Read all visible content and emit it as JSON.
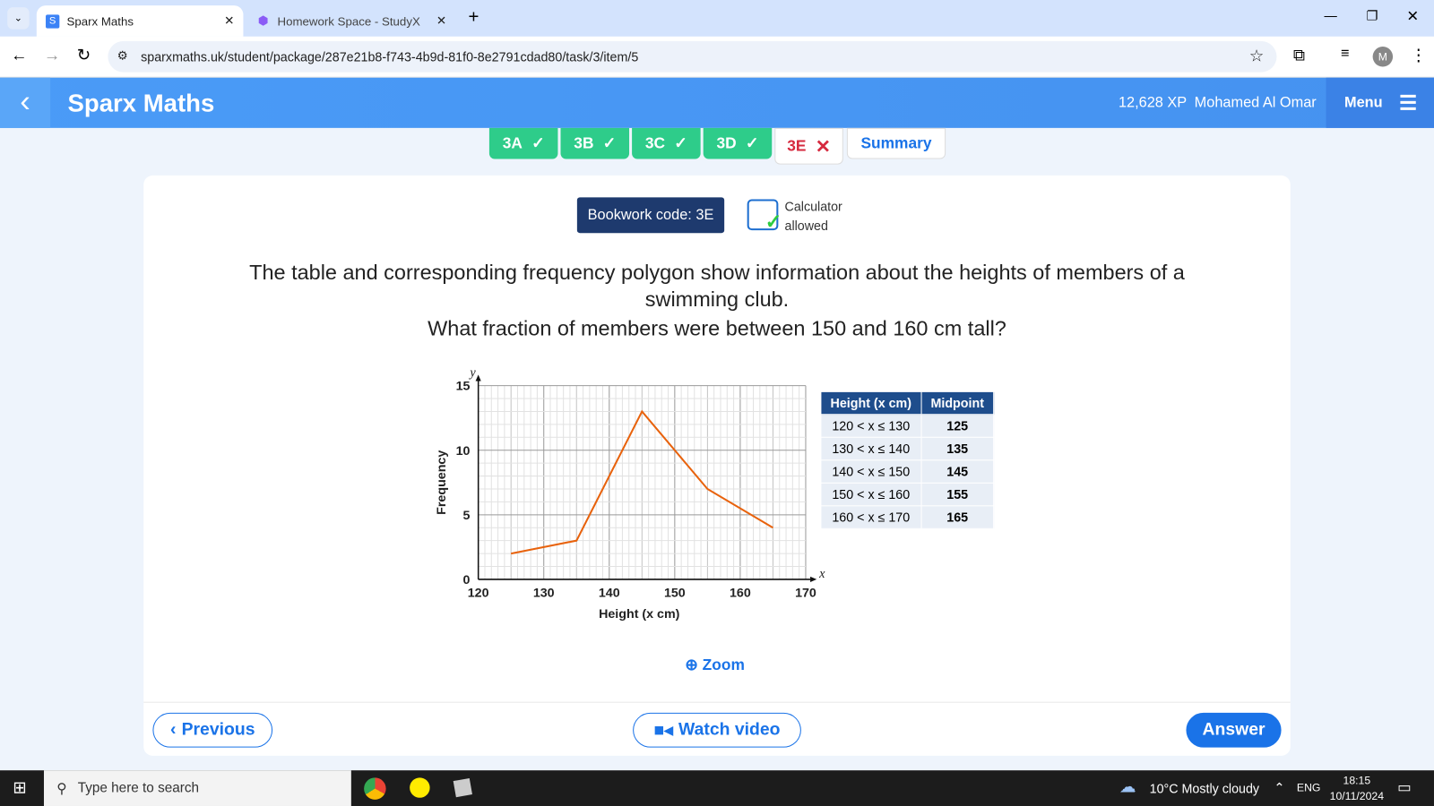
{
  "browser": {
    "tabs": [
      {
        "label": "Sparx Maths",
        "favicon": "S"
      },
      {
        "label": "Homework Space - StudyX"
      }
    ],
    "url": "sparxmaths.uk/student/package/287e21b8-f743-4b9d-81f0-8e2791cdad80/task/3/item/5",
    "profile": "M"
  },
  "header": {
    "title": "Sparx Maths",
    "xp": "12,628 XP",
    "user": "Mohamed Al Omar",
    "menu": "Menu"
  },
  "task_tabs": [
    {
      "label": "3A",
      "status": "done"
    },
    {
      "label": "3B",
      "status": "done"
    },
    {
      "label": "3C",
      "status": "done"
    },
    {
      "label": "3D",
      "status": "done"
    },
    {
      "label": "3E",
      "status": "wrong"
    },
    {
      "label": "Summary"
    }
  ],
  "bookwork": "Bookwork code: 3E",
  "calculator": [
    "Calculator",
    "allowed"
  ],
  "question": {
    "line1": "The table and corresponding frequency polygon show information about the heights of members of a",
    "line2": "swimming club.",
    "line3": "What fraction of members were between 150 and 160 cm tall?"
  },
  "table": {
    "headers": [
      "Height (x cm)",
      "Midpoint"
    ],
    "rows": [
      [
        "120 < x ≤ 130",
        "125"
      ],
      [
        "130 < x ≤ 140",
        "135"
      ],
      [
        "140 < x ≤ 150",
        "145"
      ],
      [
        "150 < x ≤ 160",
        "155"
      ],
      [
        "160 < x ≤ 170",
        "165"
      ]
    ]
  },
  "chart_data": {
    "type": "line",
    "xlabel": "Height (x cm)",
    "ylabel": "Frequency",
    "x_axis_var": "x",
    "y_axis_var": "y",
    "xlim": [
      120,
      170
    ],
    "ylim": [
      0,
      15
    ],
    "xticks": [
      120,
      130,
      140,
      150,
      160,
      170
    ],
    "yticks": [
      0,
      5,
      10,
      15
    ],
    "grid": true,
    "x": [
      125,
      135,
      145,
      155,
      165
    ],
    "y": [
      2,
      3,
      13,
      7,
      4
    ],
    "color": "#e8620c"
  },
  "zoom": "Zoom",
  "buttons": {
    "previous": "Previous",
    "watch": "Watch video",
    "answer": "Answer"
  },
  "taskbar": {
    "search": "Type here to search",
    "weather": "10°C  Mostly cloudy",
    "lang": "ENG",
    "time": "18:15",
    "date": "10/11/2024"
  }
}
